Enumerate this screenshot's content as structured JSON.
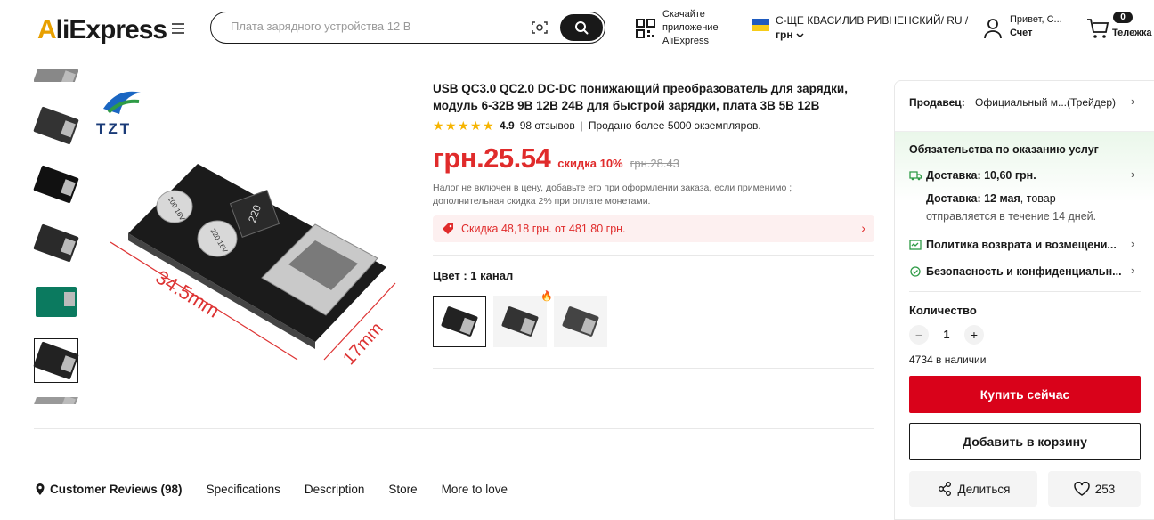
{
  "header": {
    "logo": "AliExpress",
    "search_placeholder": "Плата зарядного устройства 12 В",
    "app_line1": "Скачайте",
    "app_line2": "приложение",
    "app_line3": "AliExpress",
    "region_line1": "С-ЩЕ КВАСИЛИВ РИВНЕНСКИЙ/ RU /",
    "currency": "грн",
    "greeting": "Привет, С...",
    "account": "Счет",
    "cart_count": "0",
    "cart_label": "Тележка"
  },
  "product": {
    "brand_logo": "TZT",
    "title": "USB QC3.0 QC2.0 DC-DC понижающий преобразователь для зарядки, модуль 6-32В 9В 12В 24В для быстрой зарядки, плата 3В 5В 12В",
    "rating": "4.9",
    "reviews": "98 отзывов",
    "separator": "|",
    "sold": "Продано более 5000 экземпляров.",
    "price": "грн.25.54",
    "discount": "скидка 10%",
    "old_price": "грн.28.43",
    "tax_note": "Налог не включен в цену, добавьте его при оформлении заказа, если применимо ; дополнительная скидка 2% при оплате монетами.",
    "promo": "Скидка 48,18 грн. от 481,80 грн.",
    "color_label": "Цвет : 1 канал",
    "image_dim_length": "34.5mm",
    "image_dim_width": "17mm",
    "cap1_label": "100 16V",
    "cap2_label": "220 16V",
    "inductor_label": "220"
  },
  "tabs": [
    {
      "label": "Customer Reviews (98)"
    },
    {
      "label": "Specifications"
    },
    {
      "label": "Description"
    },
    {
      "label": "Store"
    },
    {
      "label": "More to love"
    }
  ],
  "panel": {
    "seller_label": "Продавец:",
    "seller_name": "Официальный м...(Трейдер)",
    "service_title": "Обязательства по оказанию услуг",
    "shipping": "Доставка: 10,60 грн.",
    "delivery_date_label": "Доставка: 12 мая",
    "delivery_suffix": ", товар",
    "delivery_note": "отправляется в течение 14 дней.",
    "returns": "Политика возврата и возмещени...",
    "security": "Безопасность и конфиденциальн...",
    "qty_label": "Количество",
    "qty_value": "1",
    "minus": "−",
    "plus": "+",
    "stock": "4734 в наличии",
    "buy_now": "Купить сейчас",
    "add_to_cart": "Добавить в корзину",
    "share": "Делиться",
    "likes": "253"
  },
  "colors": {
    "accent_red": "#e02b2b",
    "buy_red": "#d9021a",
    "star": "#f6b400"
  }
}
